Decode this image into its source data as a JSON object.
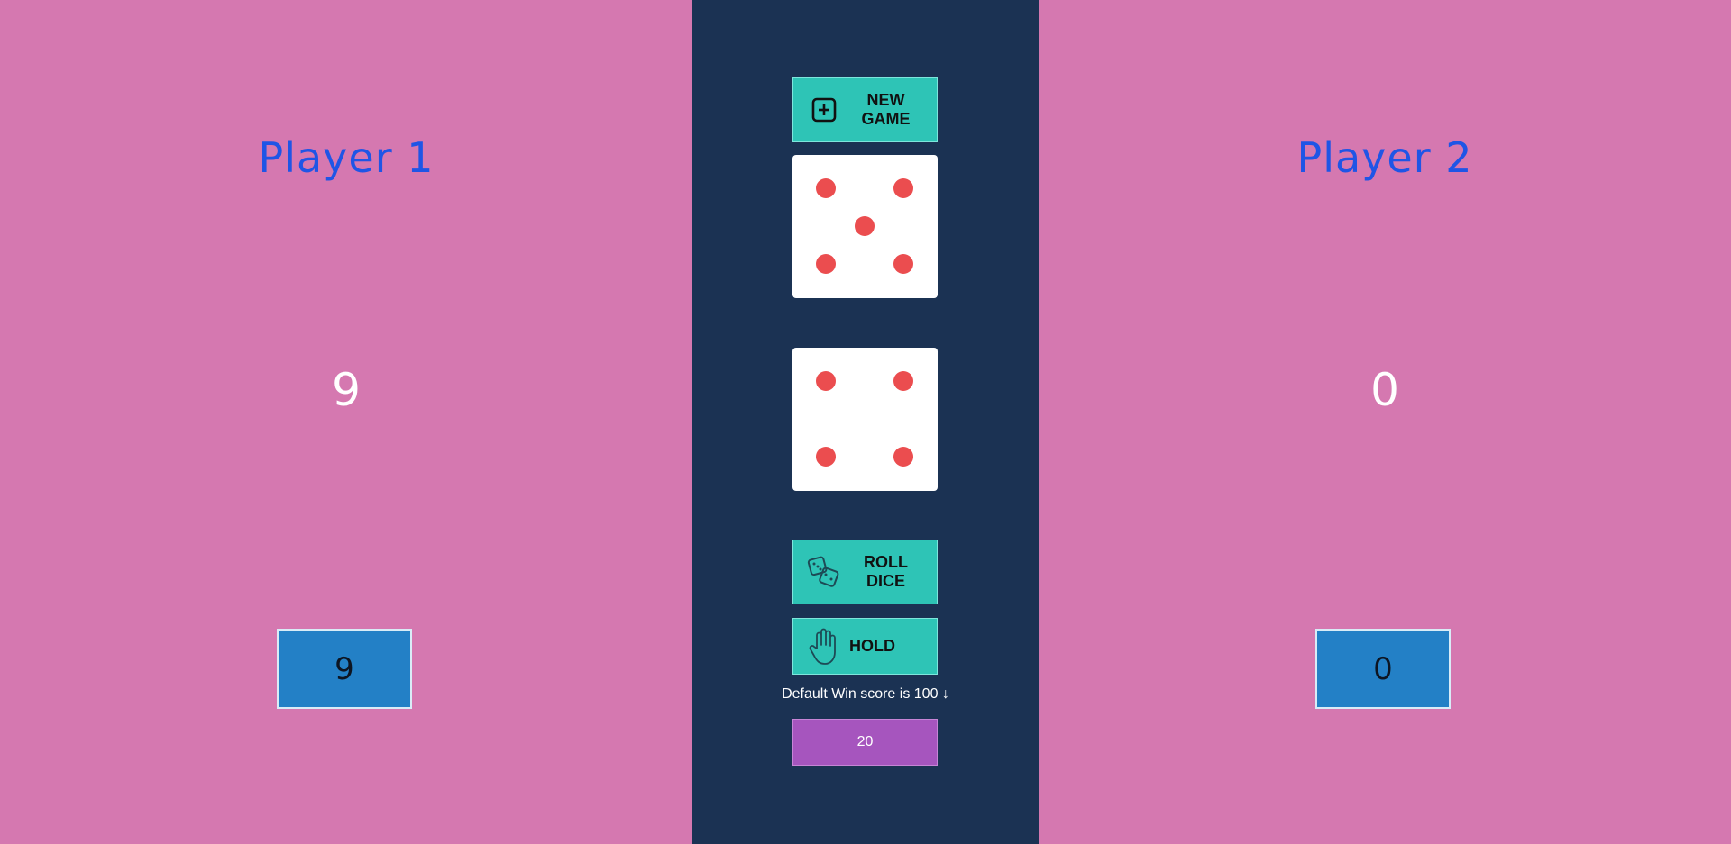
{
  "player1": {
    "name": "Player 1",
    "total": "9",
    "current": "9"
  },
  "player2": {
    "name": "Player 2",
    "total": "0",
    "current": "0"
  },
  "controls": {
    "new_game_label": "NEW\nGAME",
    "new_game_icon": "plus-square-icon",
    "roll_label": "ROLL\nDICE",
    "roll_icon": "dice-icon",
    "hold_label": "HOLD",
    "hold_icon": "hand-icon"
  },
  "dice": [
    {
      "value": 5
    },
    {
      "value": 4
    }
  ],
  "win": {
    "text": "Default Win score is 100 ↓",
    "value": "20"
  },
  "colors": {
    "side": "#d578b0",
    "center": "#1b3253",
    "button": "#2ec4b6",
    "pip": "#eb4d4f",
    "name": "#1f55e6",
    "current": "#2380c6",
    "input": "#a655be"
  }
}
